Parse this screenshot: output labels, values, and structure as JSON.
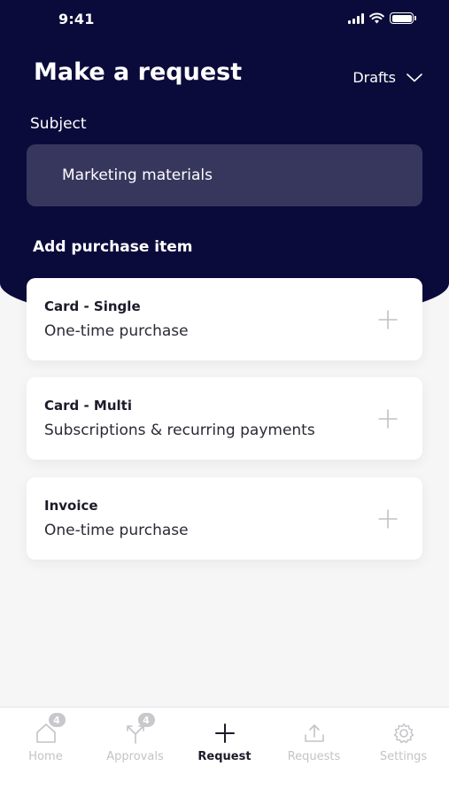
{
  "status_bar": {
    "time": "9:41"
  },
  "header": {
    "title": "Make a request",
    "drafts_label": "Drafts"
  },
  "subject": {
    "label": "Subject",
    "value": "Marketing materials"
  },
  "purchase": {
    "section_label": "Add purchase item",
    "items": [
      {
        "title": "Card - Single",
        "subtitle": "One-time purchase"
      },
      {
        "title": "Card - Multi",
        "subtitle": "Subscriptions & recurring payments"
      },
      {
        "title": "Invoice",
        "subtitle": "One-time purchase"
      }
    ]
  },
  "tabbar": {
    "tabs": [
      {
        "label": "Home",
        "icon": "home-icon",
        "badge": "4"
      },
      {
        "label": "Approvals",
        "icon": "approvals-icon",
        "badge": "4"
      },
      {
        "label": "Request",
        "icon": "plus-icon",
        "active": true
      },
      {
        "label": "Requests",
        "icon": "upload-tray-icon"
      },
      {
        "label": "Settings",
        "icon": "gear-icon"
      }
    ]
  },
  "colors": {
    "header_bg": "#0b0b3b",
    "subject_field_bg": "#37375e",
    "page_bg": "#f6f6f7",
    "inactive_tab": "#c3c3c8"
  }
}
